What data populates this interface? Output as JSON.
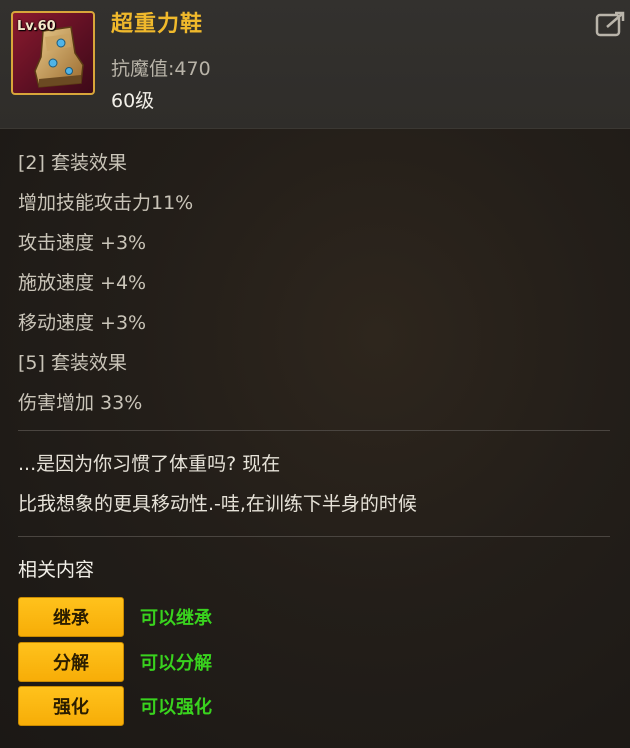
{
  "item": {
    "level_tag": "Lv.60",
    "name": "超重力鞋",
    "stat": "抗魔值:470",
    "level": "60级"
  },
  "set_effects": [
    "[2] 套装效果",
    "增加技能攻击力11%",
    "攻击速度 +3%",
    "施放速度 +4%",
    "移动速度 +3%",
    "[5] 套装效果",
    "伤害增加 33%"
  ],
  "description": [
    "...是因为你习惯了体重吗? 现在",
    "比我想象的更具移动性.-哇,在训练下半身的时候"
  ],
  "related": {
    "title": "相关内容",
    "actions": [
      {
        "label": "继承",
        "status": "可以继承"
      },
      {
        "label": "分解",
        "status": "可以分解"
      },
      {
        "label": "强化",
        "status": "可以强化"
      }
    ]
  },
  "colors": {
    "item_name": "#f0b92c",
    "button": "#ffb80f",
    "status": "#39d21e",
    "icon_border": "#d8a63a"
  },
  "icons": {
    "item_icon": "gravity-boots-icon",
    "share": "share-icon"
  }
}
